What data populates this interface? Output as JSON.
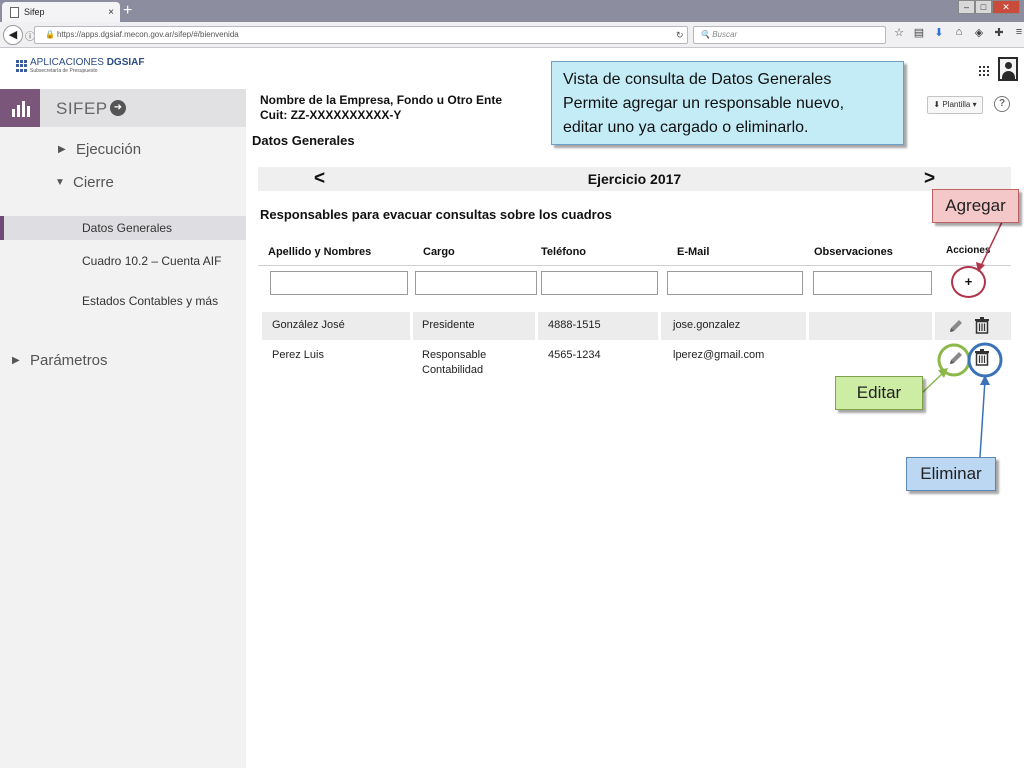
{
  "browser": {
    "tab_title": "Sifep",
    "tab_close": "×",
    "new_tab": "+",
    "window_buttons": [
      "–",
      "□",
      "✕"
    ],
    "url": "https://apps.dgsiaf.mecon.gov.ar/sifep/#/bienvenida",
    "search_placeholder": "Buscar"
  },
  "header": {
    "logo_title_light": "APLICACIONES ",
    "logo_title_bold": "DGSIAF",
    "logo_subtitle": "Subsecretaría de Presupuesto"
  },
  "sidebar": {
    "brand": "SIFEP",
    "sections": {
      "ejecucion": "Ejecución",
      "cierre": "Cierre",
      "parametros": "Parámetros"
    },
    "items": [
      {
        "label": "Datos Generales",
        "active": true
      },
      {
        "label": "Cuadro 10.2  – Cuenta AIF",
        "active": false
      },
      {
        "label": "Estados Contables y más",
        "active": false
      }
    ]
  },
  "main": {
    "company_name": "Nombre de la Empresa, Fondo u Otro Ente",
    "cuit": "Cuit: ZZ-XXXXXXXXXX-Y",
    "plantilla_label": "Plantilla",
    "help_label": "?",
    "section_title": "Datos Generales",
    "year_prev": "<",
    "year_next": ">",
    "year_label": "Ejercicio 2017",
    "responsables_title": "Responsables para evacuar consultas sobre los cuadros",
    "table": {
      "headers": [
        "Apellido y Nombres",
        "Cargo",
        "Teléfono",
        "E-Mail",
        "Observaciones",
        "Acciones"
      ],
      "add_button": "+",
      "rows": [
        {
          "nombre": "González José",
          "cargo": "Presidente",
          "telefono": "4888-1515",
          "email": "jose.gonzalez",
          "observaciones": ""
        },
        {
          "nombre": "Perez Luis",
          "cargo_line1": "Responsable",
          "cargo_line2": "Contabilidad",
          "telefono": "4565-1234",
          "email": "lperez@gmail.com",
          "observaciones": ""
        }
      ]
    }
  },
  "annotations": {
    "callout_line1": "Vista de consulta de Datos Generales",
    "callout_line2": "Permite agregar un responsable nuevo,",
    "callout_line3": "editar uno ya cargado o eliminarlo.",
    "agregar": "Agregar",
    "editar": "Editar",
    "eliminar": "Eliminar"
  },
  "colors": {
    "brand_purple": "#7a567a",
    "agregar_ring": "#b0354a",
    "editar_ring": "#8cb84a",
    "eliminar_ring": "#3a72b8"
  }
}
